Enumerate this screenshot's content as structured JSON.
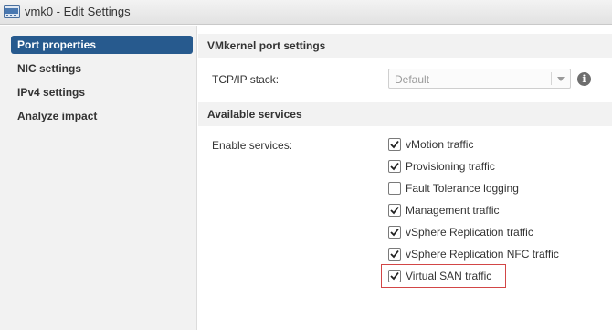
{
  "window": {
    "title": "vmk0 - Edit Settings",
    "icon": "network-adapter-icon"
  },
  "sidebar": {
    "items": [
      {
        "label": "Port properties",
        "active": true
      },
      {
        "label": "NIC settings",
        "active": false
      },
      {
        "label": "IPv4 settings",
        "active": false
      },
      {
        "label": "Analyze impact",
        "active": false
      }
    ]
  },
  "main": {
    "vmkernel_section": {
      "title": "VMkernel port settings",
      "tcpip_label": "TCP/IP stack:",
      "tcpip_value": "Default",
      "info_icon": "info-icon"
    },
    "services_section": {
      "title": "Available services",
      "enable_label": "Enable services:",
      "services": [
        {
          "label": "vMotion traffic",
          "checked": true
        },
        {
          "label": "Provisioning traffic",
          "checked": true
        },
        {
          "label": "Fault Tolerance logging",
          "checked": false
        },
        {
          "label": "Management traffic",
          "checked": true
        },
        {
          "label": "vSphere Replication traffic",
          "checked": true
        },
        {
          "label": "vSphere Replication NFC traffic",
          "checked": true
        },
        {
          "label": "Virtual SAN traffic",
          "checked": true,
          "highlighted": true
        }
      ]
    }
  },
  "colors": {
    "active_nav": "#275a8e",
    "highlight_border": "#d24646"
  }
}
